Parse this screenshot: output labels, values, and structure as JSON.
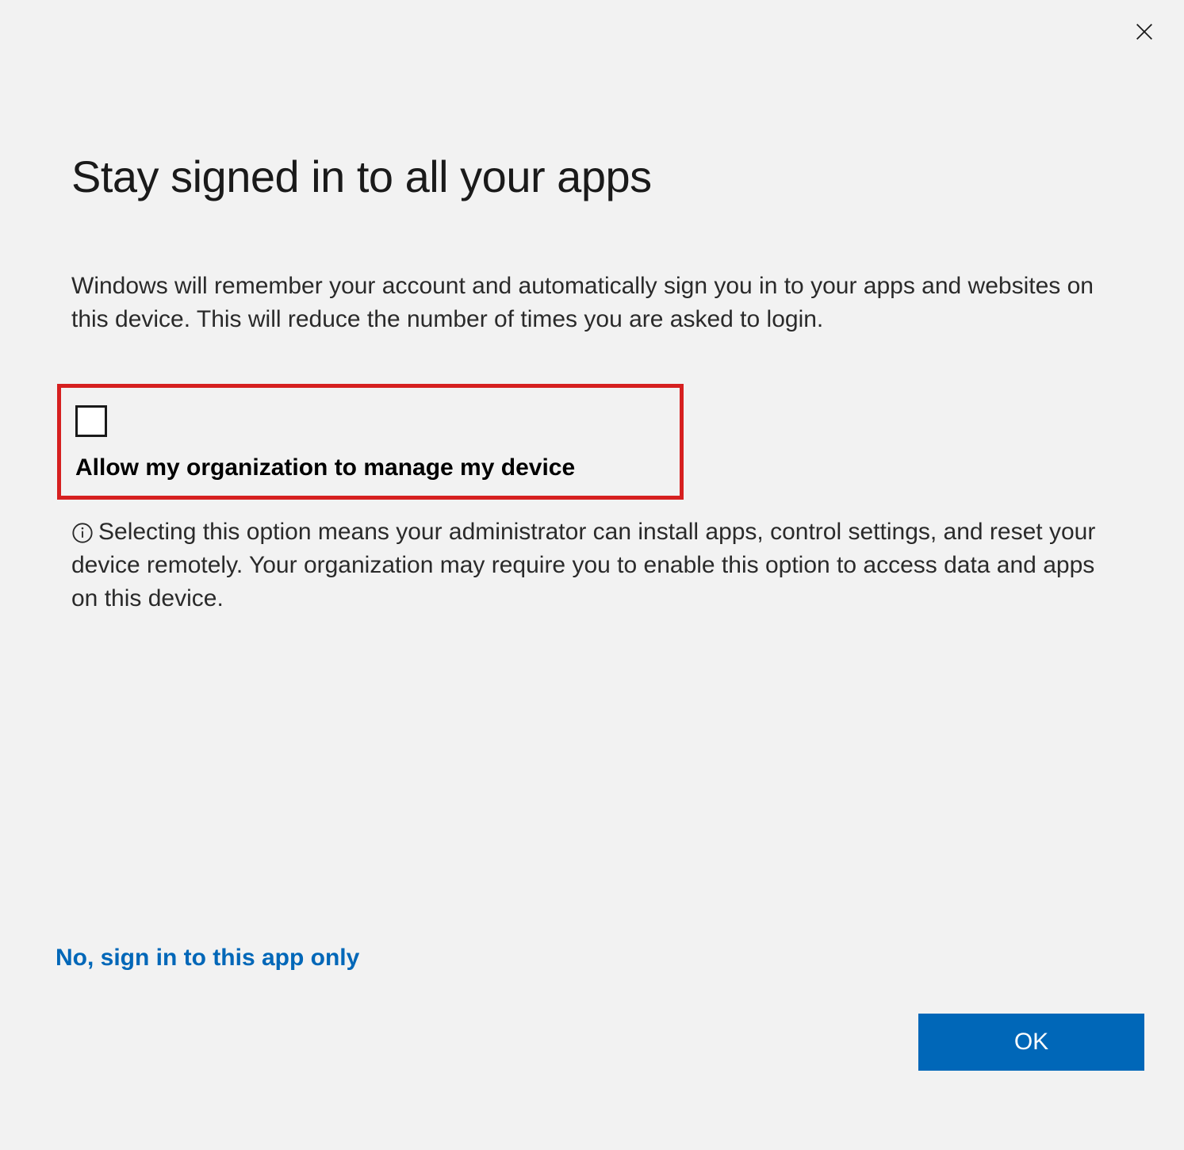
{
  "dialog": {
    "title": "Stay signed in to all your apps",
    "description": "Windows will remember your account and automatically sign you in to your apps and websites on this device. This will reduce the number of times you are asked to login.",
    "checkbox_label": "Allow my organization to manage my device",
    "info_text": "Selecting this option means your administrator can install apps, control settings, and reset your device remotely. Your organization may require you to enable this option to access data and apps on this device.",
    "link_text": "No, sign in to this app only",
    "ok_button": "OK"
  }
}
